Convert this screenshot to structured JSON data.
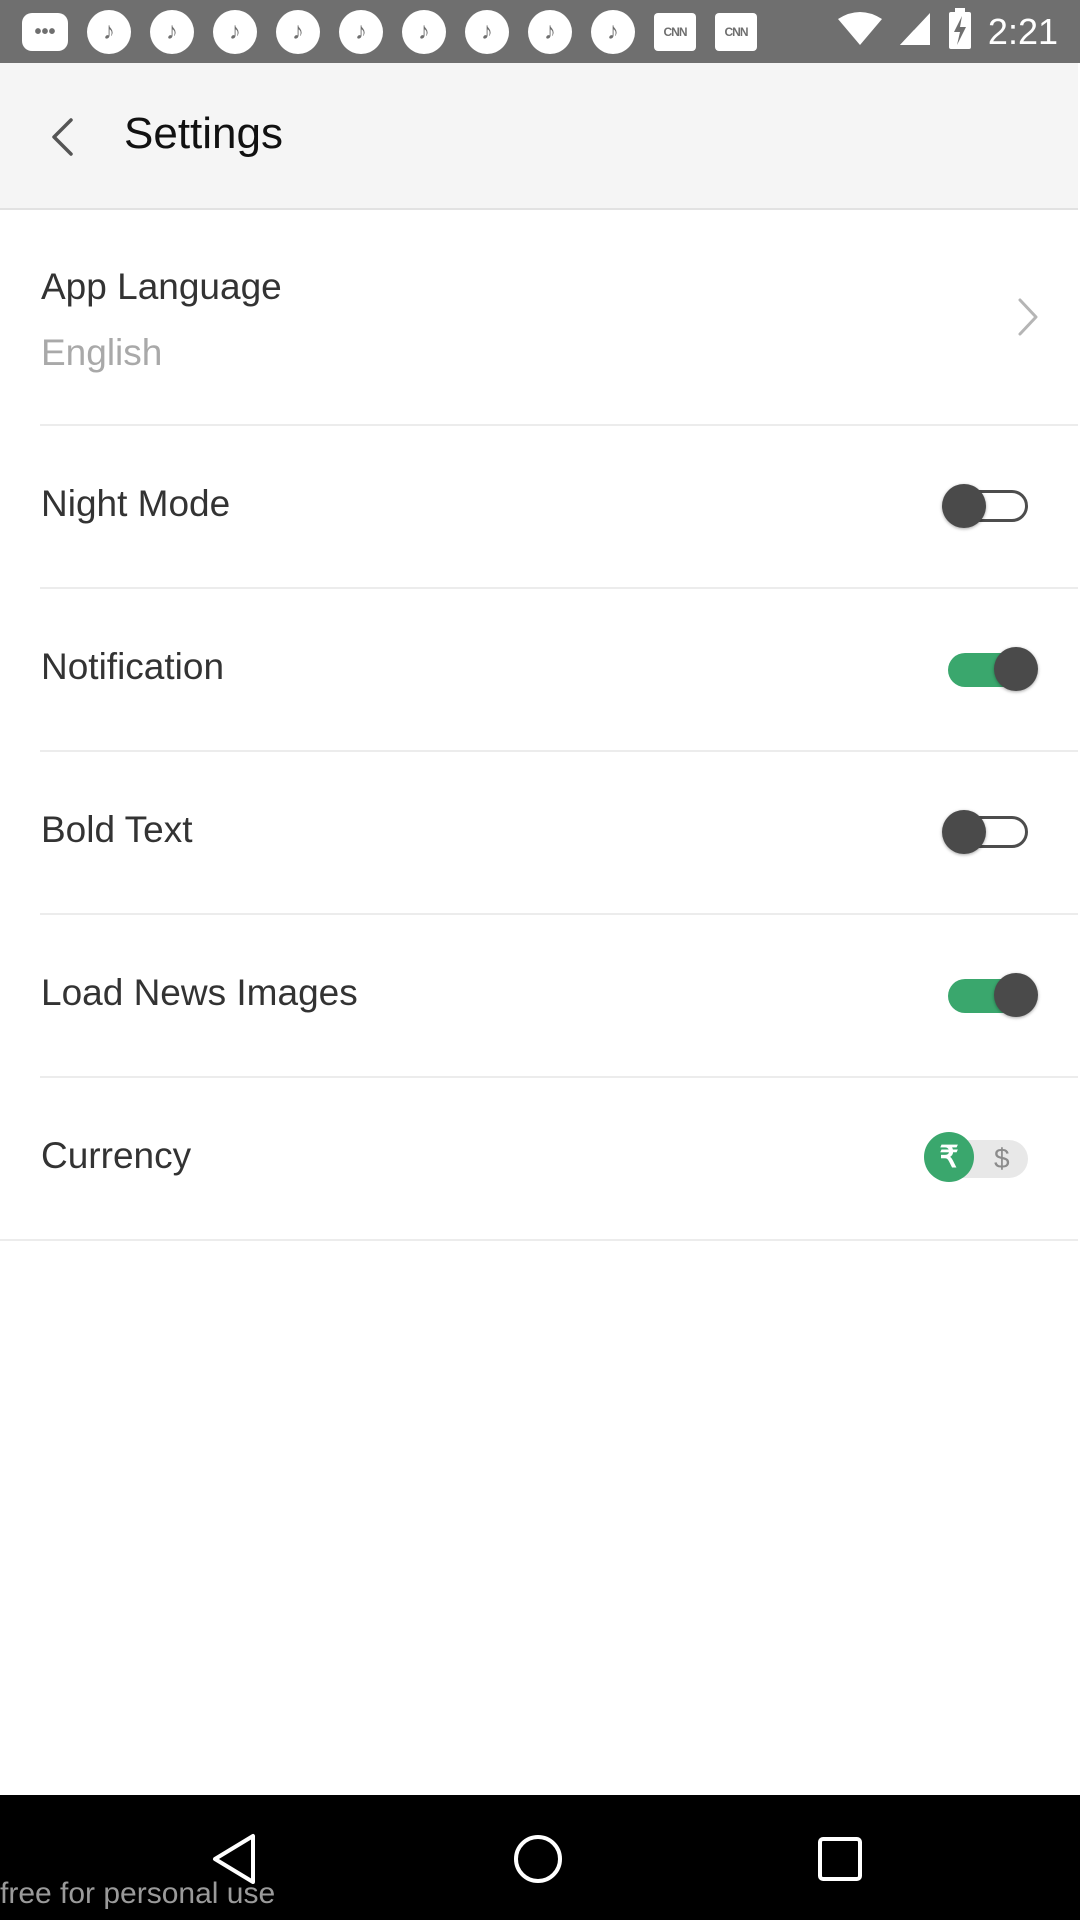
{
  "status_bar": {
    "time": "2:21",
    "notification_icons": [
      "message-icon",
      "music-app-icon",
      "music-app-icon",
      "music-app-icon",
      "music-app-icon",
      "music-app-icon",
      "music-app-icon",
      "music-app-icon",
      "music-app-icon",
      "music-app-icon",
      "news-app-icon",
      "news-app-icon"
    ],
    "cnn_label": "CNN"
  },
  "header": {
    "title": "Settings"
  },
  "settings": {
    "app_language": {
      "label": "App Language",
      "value": "English"
    },
    "night_mode": {
      "label": "Night Mode",
      "on": false
    },
    "notification": {
      "label": "Notification",
      "on": true
    },
    "bold_text": {
      "label": "Bold Text",
      "on": false
    },
    "load_news_images": {
      "label": "Load News Images",
      "on": true
    },
    "currency": {
      "label": "Currency",
      "options": [
        "₹",
        "$"
      ],
      "selected": "₹"
    }
  },
  "watermark": "free for personal use",
  "colors": {
    "accent": "#3aa76d",
    "status_bar": "#6f6f6f",
    "app_bar": "#f5f5f5",
    "toggle_thumb": "#4a4a4a"
  }
}
